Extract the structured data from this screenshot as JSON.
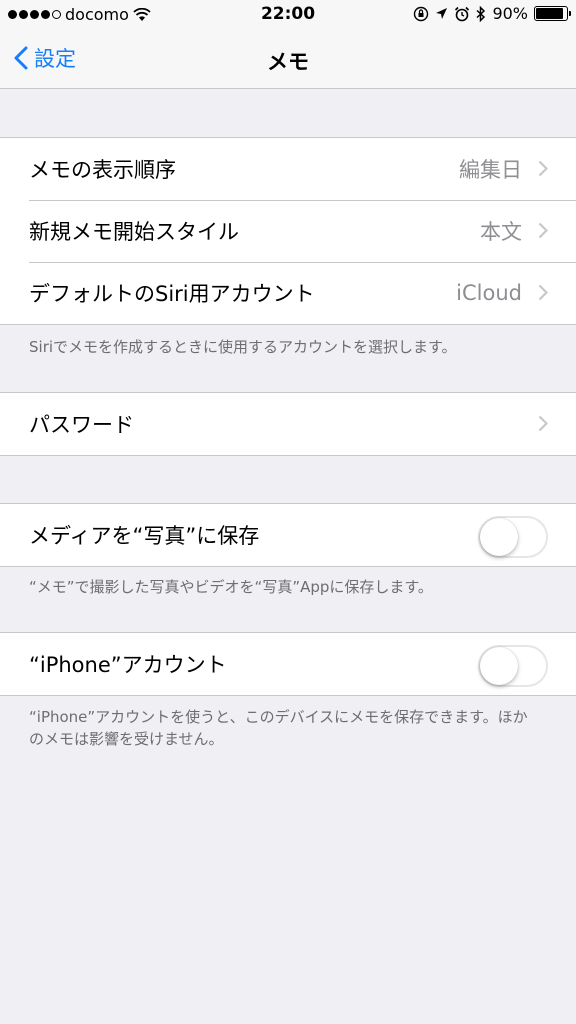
{
  "status": {
    "carrier": "docomo",
    "time": "22:00",
    "battery": "90%",
    "battery_level": 0.9
  },
  "nav": {
    "back_label": "設定",
    "title": "メモ"
  },
  "group1": {
    "rows": [
      {
        "label": "メモの表示順序",
        "value": "編集日"
      },
      {
        "label": "新規メモ開始スタイル",
        "value": "本文"
      },
      {
        "label": "デフォルトのSiri用アカウント",
        "value": "iCloud"
      }
    ],
    "footer": "Siriでメモを作成するときに使用するアカウントを選択します。"
  },
  "group2": {
    "label": "パスワード"
  },
  "group3": {
    "label": "メディアを“写真”に保存",
    "toggle_on": false,
    "footer": "“メモ”で撮影した写真やビデオを“写真”Appに保存します。"
  },
  "group4": {
    "label": "“iPhone”アカウント",
    "toggle_on": false,
    "footer": "“iPhone”アカウントを使うと、このデバイスにメモを保存できます。ほかのメモは影響を受けません。"
  }
}
